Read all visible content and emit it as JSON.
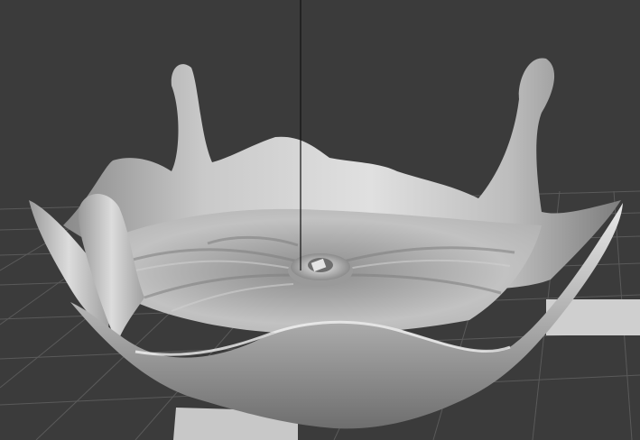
{
  "viewport": {
    "background_color": "#3b3b3b",
    "grid_color": "#5a5a5a",
    "model": "splash-crown-bowl",
    "model_color": "#a9a9a9",
    "model_highlight_color": "#d9d9d9",
    "model_shadow_color": "#5f5f5f",
    "pivot_line_color": "#111111"
  }
}
